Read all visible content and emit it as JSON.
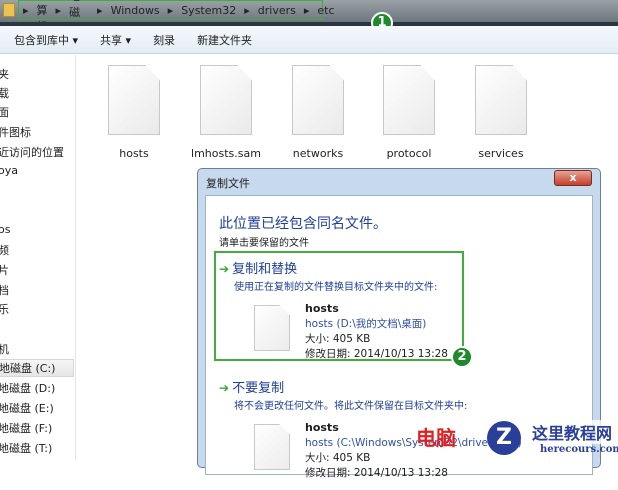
{
  "address": {
    "crumbs": [
      "计算机",
      "本地磁盘 (C:)",
      "Windows",
      "System32",
      "drivers",
      "etc"
    ]
  },
  "badges": [
    "1",
    "2"
  ],
  "toolbar": {
    "items": [
      "包含到库中 ▾",
      "共享 ▾",
      "刻录",
      "新建文件夹"
    ]
  },
  "sidebar": {
    "items": [
      "夹",
      "载",
      "面",
      "件图标",
      "近访问的位置",
      "oya",
      "os",
      "频",
      "片",
      "档",
      "乐",
      "机",
      "地磁盘 (C:)",
      "地磁盘 (D:)",
      "地磁盘 (E:)",
      "地磁盘 (F:)",
      "地磁盘 (T:)"
    ]
  },
  "files": [
    "hosts",
    "lmhosts.sam",
    "networks",
    "protocol",
    "services"
  ],
  "dialog": {
    "title": "复制文件",
    "close": "x",
    "heading": "此位置已经包含同名文件。",
    "subheading": "请单击要保留的文件",
    "options": [
      {
        "title": "复制和替换",
        "desc": "使用正在复制的文件替换目标文件夹中的文件:",
        "name": "hosts",
        "path": "hosts (D:\\我的文档\\桌面)",
        "size": "大小: 405 KB",
        "date": "修改日期: 2014/10/13 13:28"
      },
      {
        "title": "不要复制",
        "desc": "将不会更改任何文件。将此文件保留在目标文件夹中:",
        "name": "hosts",
        "path": "hosts (C:\\Windows\\System32\\drivers\\etc)",
        "size": "大小: 405 KB",
        "date": "修改日期: 2014/10/13 13:28"
      }
    ]
  },
  "watermark": {
    "text1": "电脑",
    "text2": "这里教程网",
    "text3": "herecours.com"
  }
}
